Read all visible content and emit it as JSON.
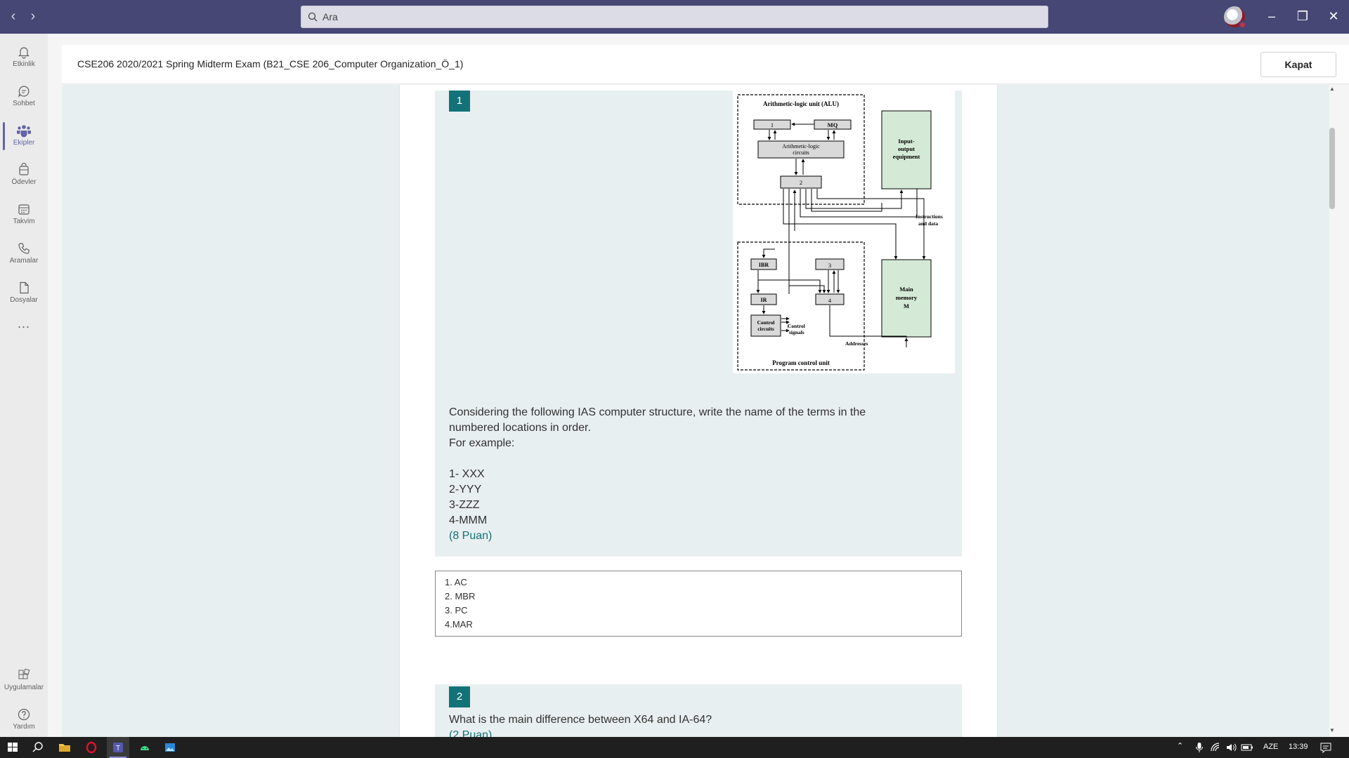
{
  "search": {
    "placeholder": "Ara"
  },
  "rail": {
    "items": [
      {
        "label": "Etkinlik",
        "icon": "bell-icon"
      },
      {
        "label": "Sohbet",
        "icon": "chat-icon"
      },
      {
        "label": "Ekipler",
        "icon": "teams-icon"
      },
      {
        "label": "Ödevler",
        "icon": "assignments-icon"
      },
      {
        "label": "Takvim",
        "icon": "calendar-icon"
      },
      {
        "label": "Aramalar",
        "icon": "phone-icon"
      },
      {
        "label": "Dosyalar",
        "icon": "file-icon"
      }
    ],
    "more": "...",
    "apps_label": "Uygulamalar",
    "help_label": "Yardım"
  },
  "header": {
    "title": "CSE206 2020/2021 Spring Midterm Exam (B21_CSE 206_Computer Organization_Ö_1)",
    "close_label": "Kapat"
  },
  "question1": {
    "number": "1",
    "text_lines": [
      "Considering the following IAS computer structure, write the name of the terms in the",
      "numbered locations in order.",
      "For example:",
      "",
      "1- XXX",
      "2-YYY",
      "3-ZZZ",
      "4-MMM"
    ],
    "points": "(8 Puan)",
    "answer_lines": [
      "1. AC",
      "2. MBR",
      "3. PC",
      "4.MAR"
    ]
  },
  "diagram": {
    "alu_title": "Arithmetic-logic unit (ALU)",
    "box1": "1",
    "mq": "MQ",
    "alc_line1": "Arithmetic-logic",
    "alc_line2": "circuits",
    "box2": "2",
    "io_line1": "Input-",
    "io_line2": "output",
    "io_line3": "equipment",
    "instr_line1": "Instructions",
    "instr_line2": "and data",
    "ibr": "IBR",
    "box3": "3",
    "ir": "IR",
    "box4": "4",
    "mm_line1": "Main",
    "mm_line2": "memory",
    "mm_line3": "M",
    "cc_line1": "Control",
    "cc_line2": "circuits",
    "cs_line1": "Control",
    "cs_line2": "signals",
    "addresses": "Addresses",
    "pcu": "Program control unit"
  },
  "question2": {
    "number": "2",
    "text": "What is the main difference between X64 and IA-64?",
    "points": "(2 Puan)"
  },
  "taskbar": {
    "lang": "AZE",
    "time": "13:39"
  },
  "colors": {
    "titlebar": "#464775",
    "accent": "#6264a7",
    "teal": "#127277",
    "io_fill": "#d5ead6"
  }
}
